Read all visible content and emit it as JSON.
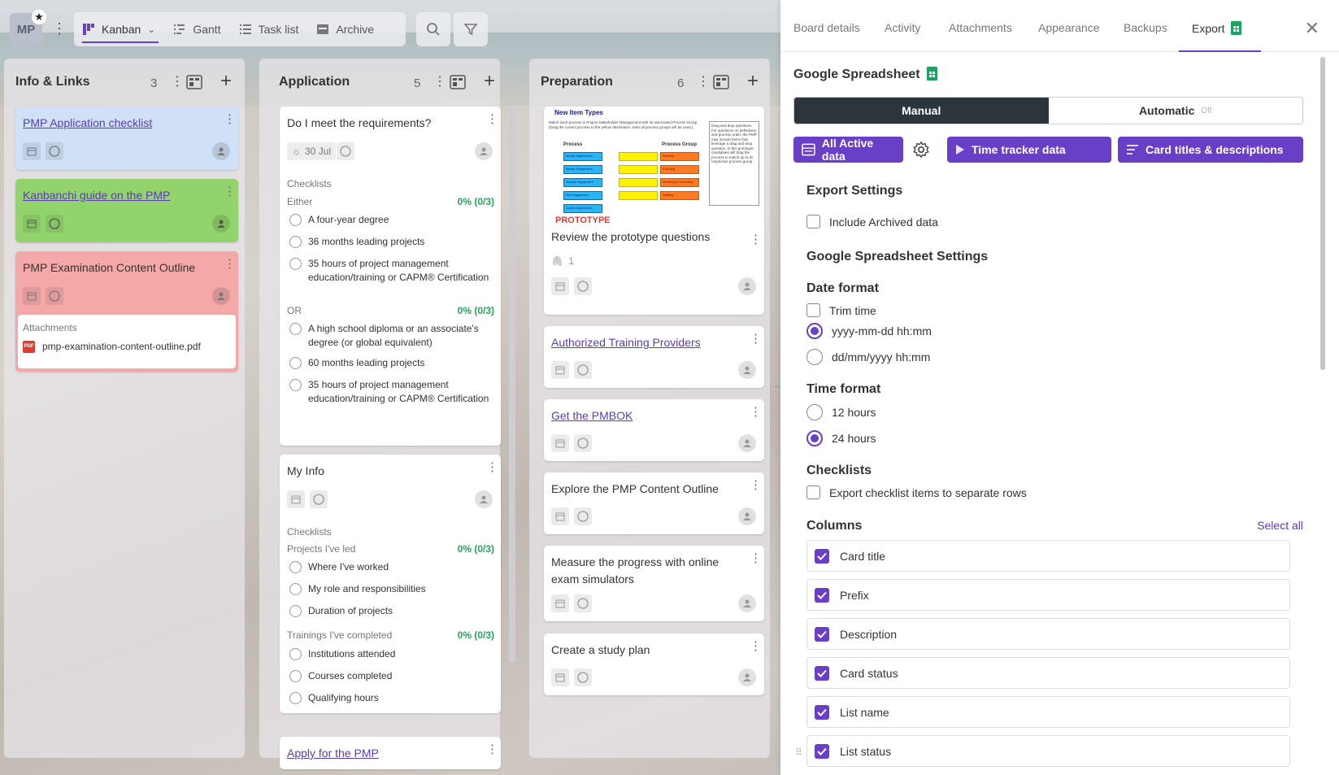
{
  "topbar": {
    "avatar_initials": "MP",
    "views": [
      {
        "label": "Kanban",
        "icon": "kanban-icon",
        "active": true
      },
      {
        "label": "Gantt",
        "icon": "gantt-icon"
      },
      {
        "label": "Task list",
        "icon": "task-list-icon"
      },
      {
        "label": "Archive",
        "icon": "archive-icon"
      }
    ]
  },
  "lists": [
    {
      "title": "Info & Links",
      "count": "3",
      "cards": [
        {
          "title": "PMP Application checklist",
          "link": true,
          "color": "#cfe0f7"
        },
        {
          "title": "Kanbanchi guide on the PMP",
          "link": true,
          "color": "#92d46b"
        },
        {
          "title": "PMP Examination Content Outline",
          "link": false,
          "color": "#f4a8a8",
          "attachments_label": "Attachments",
          "attachment": "pmp-examination-content-outline.pdf",
          "pdf_badge": "PDF"
        }
      ]
    },
    {
      "title": "Application",
      "count": "5",
      "cards": [
        {
          "title": "Do I meet the requirements?",
          "date": "30 Jul",
          "checklists_label": "Checklists",
          "groups": [
            {
              "name": "Either",
              "pct": "0% (0/3)",
              "items": [
                "A four-year degree",
                "36 months leading projects",
                "35 hours of project management education/training or CAPM® Certification"
              ]
            },
            {
              "name": "OR",
              "pct": "0% (0/3)",
              "items": [
                "A high school diploma or an associate's degree (or global equivalent)",
                "60 months leading projects",
                "35 hours of project management education/training or CAPM® Certification"
              ]
            }
          ]
        },
        {
          "title": "My Info",
          "checklists_label": "Checklists",
          "groups": [
            {
              "name": "Projects I've led",
              "pct": "0% (0/3)",
              "items": [
                "Where I've worked",
                "My role and responsibilities",
                "Duration of projects"
              ]
            },
            {
              "name": "Trainings I've completed",
              "pct": "0% (0/3)",
              "items": [
                "Institutions attended",
                "Courses completed",
                "Qualifying hours"
              ]
            }
          ]
        },
        {
          "title": "Apply for the PMP",
          "link": true
        }
      ]
    },
    {
      "title": "Preparation",
      "count": "6",
      "cards": [
        {
          "title": "Review the prototype questions",
          "attachments_count": "1",
          "thumb": {
            "heading": "New Item Types",
            "intro": "Match each process in Project Stakeholder Management with its associated Process Group. (Drag the correct process to the yellow destination. Note all process groups will be used.)",
            "col1": "Process",
            "col2": "Process Group",
            "tag": "PROTOTYPE",
            "side_text": "Drag and drop questions  For questions on definitions and process order, the PMP may include items that leverage a drag and drop question. In this prototype, candidates will drag the process to match up to its respective process group.",
            "processes": [
              "Identify Stakeholders",
              "Monitor Engagement",
              "Manage Engagement",
              "Plan Engagement",
              "Control Stakeholders"
            ],
            "groups": [
              "Planning",
              "Executing",
              "Monitoring & Controlling",
              "Initiating"
            ]
          }
        },
        {
          "title": "Authorized Training Providers",
          "link": true
        },
        {
          "title": "Get the PMBOK",
          "link": true
        },
        {
          "title": "Explore the PMP Content Outline"
        },
        {
          "title": "Measure the progress with online exam simulators"
        },
        {
          "title": "Create a study plan"
        }
      ]
    }
  ],
  "panel": {
    "tabs": [
      "Board details",
      "Activity",
      "Attachments",
      "Appearance",
      "Backups",
      "Export"
    ],
    "active_tab": "Export",
    "heading": "Google Spreadsheet",
    "mode_manual": "Manual",
    "mode_automatic": "Automatic",
    "mode_automatic_state": "Off",
    "buttons": {
      "all_active": "All Active data",
      "time_tracker": "Time tracker data",
      "titles_desc": "Card titles & descriptions"
    },
    "export_settings": {
      "title": "Export Settings",
      "include_archived": "Include Archived data"
    },
    "sheet_settings_title": "Google Spreadsheet Settings",
    "date_format": {
      "title": "Date format",
      "trim_time": "Trim time",
      "opt1": "yyyy-mm-dd hh:mm",
      "opt2": "dd/mm/yyyy hh:mm"
    },
    "time_format": {
      "title": "Time format",
      "opt1": "12 hours",
      "opt2": "24 hours"
    },
    "checklists": {
      "title": "Checklists",
      "separate_rows": "Export checklist items to separate rows"
    },
    "columns": {
      "title": "Columns",
      "select_all": "Select all",
      "items": [
        "Card title",
        "Prefix",
        "Description",
        "Card status",
        "List name",
        "List status"
      ]
    },
    "accent": "#6a3fc8"
  }
}
